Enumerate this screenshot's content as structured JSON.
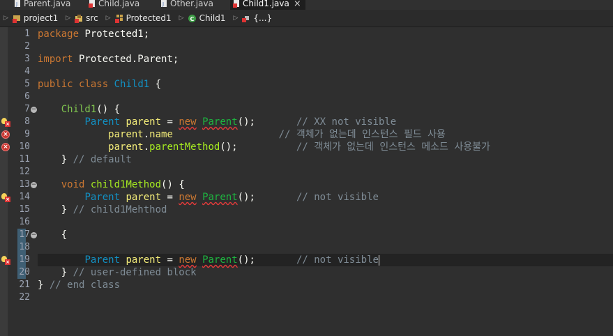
{
  "tabs": [
    {
      "label": "Parent.java",
      "icon": "java-file-icon",
      "active": false
    },
    {
      "label": "Child.java",
      "icon": "java-file-error-icon",
      "active": false
    },
    {
      "label": "Other.java",
      "icon": "java-file-icon",
      "active": false
    },
    {
      "label": "Child1.java",
      "icon": "java-file-error-icon",
      "active": true,
      "close": "×"
    }
  ],
  "breadcrumb": [
    {
      "label": "project1",
      "icon": "project-error-icon"
    },
    {
      "label": "src",
      "icon": "source-folder-error-icon"
    },
    {
      "label": "Protected1",
      "icon": "package-error-icon"
    },
    {
      "label": "Child1",
      "icon": "class-icon"
    },
    {
      "label": "{...}",
      "icon": "block-error-icon"
    }
  ],
  "lines": [
    {
      "n": "1",
      "tokens": [
        [
          "kw",
          "package"
        ],
        [
          "plain",
          " Protected1;"
        ]
      ]
    },
    {
      "n": "2",
      "tokens": []
    },
    {
      "n": "3",
      "tokens": [
        [
          "kw",
          "import"
        ],
        [
          "plain",
          " Protected.Parent;"
        ]
      ]
    },
    {
      "n": "4",
      "tokens": []
    },
    {
      "n": "5",
      "tokens": [
        [
          "kw",
          "public"
        ],
        [
          "plain",
          " "
        ],
        [
          "kw",
          "class"
        ],
        [
          "plain",
          " "
        ],
        [
          "type",
          "Child1"
        ],
        [
          "plain",
          " {"
        ]
      ]
    },
    {
      "n": "6",
      "tokens": []
    },
    {
      "n": "7",
      "tokens": [
        [
          "plain",
          "    "
        ],
        [
          "ctor",
          "Child1"
        ],
        [
          "plain",
          "() {"
        ]
      ],
      "fold": "−"
    },
    {
      "n": "8",
      "tokens": [
        [
          "plain",
          "        "
        ],
        [
          "type",
          "Parent"
        ],
        [
          "plain",
          " "
        ],
        [
          "var",
          "parent"
        ],
        [
          "plain",
          " = "
        ],
        [
          "kwsq",
          "new"
        ],
        [
          "plain",
          " "
        ],
        [
          "typesq",
          "Parent"
        ],
        [
          "plain",
          "();       "
        ],
        [
          "cmt",
          "// XX not visible"
        ]
      ],
      "marker": "bulb-error"
    },
    {
      "n": "9",
      "tokens": [
        [
          "plain",
          "            "
        ],
        [
          "var",
          "parent"
        ],
        [
          "plain",
          "."
        ],
        [
          "field",
          "name"
        ],
        [
          "plain",
          "                  "
        ],
        [
          "cmt",
          "// 객체가 없는데 인스턴스 필드 사용"
        ]
      ],
      "marker": "error"
    },
    {
      "n": "10",
      "tokens": [
        [
          "plain",
          "            "
        ],
        [
          "var",
          "parent"
        ],
        [
          "plain",
          "."
        ],
        [
          "method",
          "parentMethod"
        ],
        [
          "plain",
          "();          "
        ],
        [
          "cmt",
          "// 객체가 없는데 인스턴스 메소드 사용불가"
        ]
      ],
      "marker": "error"
    },
    {
      "n": "11",
      "tokens": [
        [
          "plain",
          "    } "
        ],
        [
          "cmt",
          "// default"
        ]
      ]
    },
    {
      "n": "12",
      "tokens": []
    },
    {
      "n": "13",
      "tokens": [
        [
          "plain",
          "    "
        ],
        [
          "kw",
          "void"
        ],
        [
          "plain",
          " "
        ],
        [
          "method",
          "child1Method"
        ],
        [
          "plain",
          "() {"
        ]
      ],
      "fold": "−"
    },
    {
      "n": "14",
      "tokens": [
        [
          "plain",
          "        "
        ],
        [
          "type",
          "Parent"
        ],
        [
          "plain",
          " "
        ],
        [
          "var",
          "parent"
        ],
        [
          "plain",
          " = "
        ],
        [
          "kwsq",
          "new"
        ],
        [
          "plain",
          " "
        ],
        [
          "typesq",
          "Parent"
        ],
        [
          "plain",
          "();       "
        ],
        [
          "cmt",
          "// not visible"
        ]
      ],
      "marker": "bulb-error"
    },
    {
      "n": "15",
      "tokens": [
        [
          "plain",
          "    } "
        ],
        [
          "cmt",
          "// child1Mehthod"
        ]
      ]
    },
    {
      "n": "16",
      "tokens": []
    },
    {
      "n": "17",
      "tokens": [
        [
          "plain",
          "    {"
        ]
      ],
      "fold": "−",
      "sel": true
    },
    {
      "n": "18",
      "tokens": [],
      "sel": true
    },
    {
      "n": "19",
      "tokens": [
        [
          "plain",
          "        "
        ],
        [
          "type",
          "Parent"
        ],
        [
          "plain",
          " "
        ],
        [
          "var",
          "parent"
        ],
        [
          "plain",
          " = "
        ],
        [
          "kwsq",
          "new"
        ],
        [
          "plain",
          " "
        ],
        [
          "typesq",
          "Parent"
        ],
        [
          "plain",
          "();       "
        ],
        [
          "cmt",
          "// not visible"
        ],
        [
          "caret",
          ""
        ]
      ],
      "marker": "bulb-error",
      "sel": true,
      "current": true
    },
    {
      "n": "20",
      "tokens": [
        [
          "plain",
          "    } "
        ],
        [
          "cmt",
          "// user-defined block"
        ]
      ],
      "sel": true
    },
    {
      "n": "21",
      "tokens": [
        [
          "plain",
          "} "
        ],
        [
          "cmt",
          "// end class"
        ]
      ]
    },
    {
      "n": "22",
      "tokens": []
    }
  ]
}
